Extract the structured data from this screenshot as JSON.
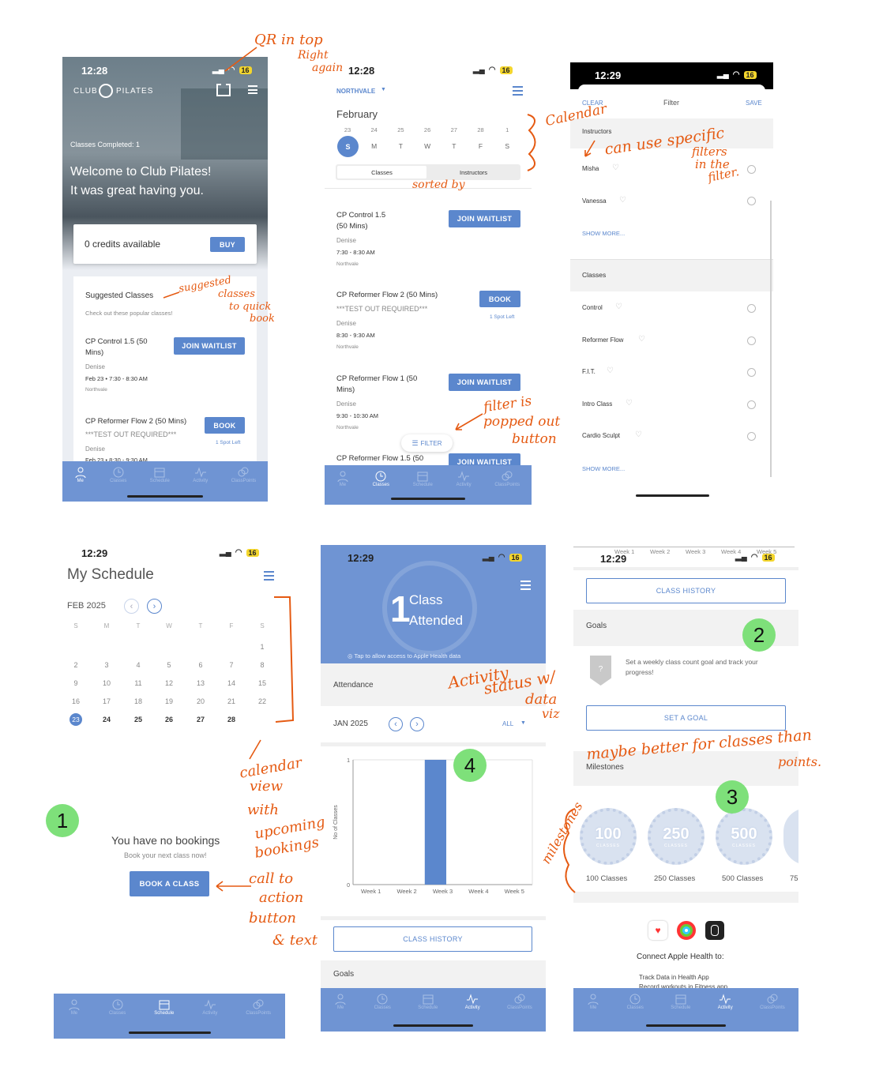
{
  "status_bar": {
    "time_a": "12:28",
    "time_b": "12:28",
    "time_c": "12:29",
    "time_d": "12:29",
    "time_e": "12:29",
    "time_f": "12:29",
    "battery": "16"
  },
  "nav": {
    "me": "Me",
    "classes": "Classes",
    "schedule": "Schedule",
    "activity": "Activity",
    "classpoints": "ClassPoints"
  },
  "screen1": {
    "brand_left": "CLUB",
    "brand_right": "PILATES",
    "classes_completed": "Classes Completed: 1",
    "welcome_line1": "Welcome to Club Pilates!",
    "welcome_line2": "It was great having you.",
    "credits": "0 credits available",
    "buy": "BUY",
    "suggested_title": "Suggested Classes",
    "suggested_sub": "Check out these popular classes!",
    "c1_name1": "CP Control 1.5 (50",
    "c1_name2": "Mins)",
    "c1_instructor": "Denise",
    "c1_time": "Feb 23 • 7:30 - 8:30 AM",
    "c1_loc": "Northvale",
    "c1_btn": "JOIN WAITLIST",
    "c2_name": "CP Reformer Flow 2 (50 Mins)",
    "c2_note": "***TEST OUT REQUIRED***",
    "c2_instructor": "Denise",
    "c2_time": "Feb 23 • 8:30 - 9:30 AM",
    "c2_btn": "BOOK",
    "c2_spots": "1 Spot Left"
  },
  "screen2": {
    "location": "NORTHVALE",
    "month": "February",
    "dates": [
      "23",
      "24",
      "25",
      "26",
      "27",
      "28",
      "1"
    ],
    "days": [
      "S",
      "M",
      "T",
      "W",
      "T",
      "F",
      "S"
    ],
    "tab_classes": "Classes",
    "tab_instructors": "Instructors",
    "k1_name1": "CP Control 1.5",
    "k1_name2": "(50 Mins)",
    "k1_instr": "Denise",
    "k1_time": "7:30 - 8:30 AM",
    "k1_loc": "Northvale",
    "k1_btn": "JOIN WAITLIST",
    "k2_name": "CP Reformer Flow 2 (50 Mins)",
    "k2_note": "***TEST OUT REQUIRED***",
    "k2_instr": "Denise",
    "k2_time": "8:30 - 9:30 AM",
    "k2_loc": "Northvale",
    "k2_btn": "BOOK",
    "k2_spots": "1 Spot Left",
    "k3_name1": "CP Reformer Flow 1 (50",
    "k3_name2": "Mins)",
    "k3_instr": "Denise",
    "k3_time": "9:30 - 10:30 AM",
    "k3_loc": "Northvale",
    "k3_btn": "JOIN WAITLIST",
    "k4_name": "CP Reformer Flow 1.5 (50",
    "k4_btn": "JOIN WAITLIST",
    "filter": "FILTER"
  },
  "screen3": {
    "clear": "CLEAR",
    "title": "Filter",
    "save": "SAVE",
    "instructors": "Instructors",
    "i1": "Misha",
    "i2": "Vanessa",
    "show_more": "SHOW MORE...",
    "classes": "Classes",
    "cl1": "Control",
    "cl2": "Reformer Flow",
    "cl3": "F.I.T.",
    "cl4": "Intro Class",
    "cl5": "Cardio Sculpt",
    "show_more2": "SHOW MORE..."
  },
  "screen4": {
    "title": "My Schedule",
    "month": "FEB 2025",
    "dow": [
      "S",
      "M",
      "T",
      "W",
      "T",
      "F",
      "S"
    ],
    "weeks": [
      [
        "",
        "",
        "",
        "",
        "",
        "",
        "1"
      ],
      [
        "2",
        "3",
        "4",
        "5",
        "6",
        "7",
        "8"
      ],
      [
        "9",
        "10",
        "11",
        "12",
        "13",
        "14",
        "15"
      ],
      [
        "16",
        "17",
        "18",
        "19",
        "20",
        "21",
        "22"
      ],
      [
        "23",
        "24",
        "25",
        "26",
        "27",
        "28",
        ""
      ]
    ],
    "no_bookings": "You have no bookings",
    "no_bookings_sub": "Book your next class now!",
    "book": "BOOK A CLASS"
  },
  "screen5": {
    "big_num": "1",
    "class_word": "Class",
    "attended": "Attended",
    "health_note": "Tap to allow access to Apple Health data",
    "attendance": "Attendance",
    "month": "JAN 2025",
    "all": "ALL",
    "class_history": "CLASS HISTORY",
    "goals": "Goals"
  },
  "chart_data": {
    "type": "bar",
    "categories": [
      "Week 1",
      "Week 2",
      "Week 3",
      "Week 4",
      "Week 5"
    ],
    "values": [
      0,
      0,
      1,
      0,
      0
    ],
    "ylabel": "No of Classes",
    "ylim": [
      0,
      1
    ],
    "yticks": [
      "0",
      "1"
    ],
    "color": "#5b87cd"
  },
  "screen6": {
    "weeks_top": [
      "Week 1",
      "Week 2",
      "Week 3",
      "Week 4",
      "Week 5"
    ],
    "class_history": "CLASS HISTORY",
    "goals": "Goals",
    "goal_text1": "Set a weekly class count goal and track your",
    "goal_text2": "progress!",
    "set_goal": "SET A GOAL",
    "milestones": "Milestones",
    "m_nums": [
      "100",
      "250",
      "500"
    ],
    "m_labels": [
      "100 Classes",
      "250 Classes",
      "500 Classes",
      "75"
    ],
    "m_sub": "CLASSES",
    "connect": "Connect Apple Health to:",
    "track1": "Track Data in Health App",
    "track2": "Record workouts in Fitness app"
  },
  "annotations": {
    "qr1": "QR in top",
    "qr2": "Right",
    "qr3": "again",
    "cal": "Calendar",
    "sorted": "sorted by",
    "sug1": "suggested",
    "sug2": "classes",
    "sug3": "to quick",
    "sug4": "book",
    "filt1": "filter is",
    "filt2": "popped out",
    "filt3": "button",
    "spec1": "can use specific",
    "spec2": "filters",
    "spec3": "in the",
    "spec4": "filter.",
    "calv1": "calendar",
    "calv2": "view",
    "calv3": "with",
    "calv4": "upcoming",
    "calv5": "bookings",
    "cta1": "call to",
    "cta2": "action",
    "cta3": "button",
    "cta4": "& text",
    "act1": "Activity",
    "act2": "status w/",
    "act3": "data",
    "act4": "viz",
    "mile1": "maybe better for classes than",
    "mile2": "points.",
    "mile3": "milestones"
  },
  "badges": [
    "1",
    "2",
    "3",
    "4"
  ]
}
